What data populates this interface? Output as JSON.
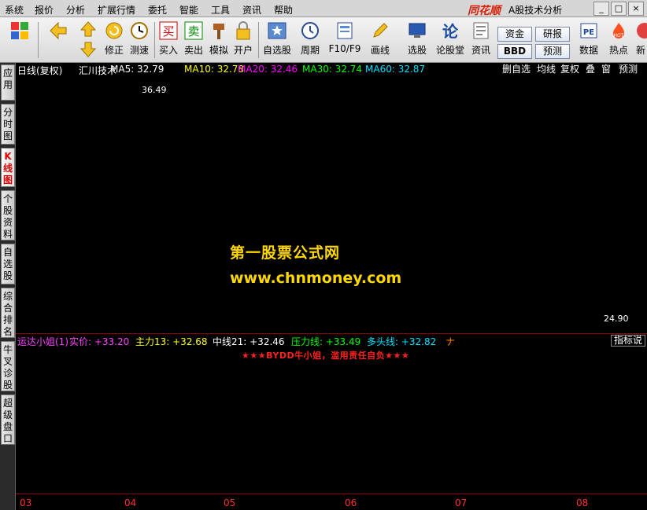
{
  "menubar": {
    "items": [
      "系统",
      "报价",
      "分析",
      "扩展行情",
      "委托",
      "智能",
      "工具",
      "资讯",
      "帮助"
    ],
    "brand": "同花顺",
    "app_title": "A股技术分析"
  },
  "toolbar": {
    "buttons": [
      "修正",
      "测速",
      "买入",
      "卖出",
      "模拟",
      "开户",
      "自选股",
      "周期",
      "F10/F9",
      "画线",
      "选股",
      "论股堂",
      "资讯",
      "数据",
      "热点",
      "新"
    ],
    "small_buttons": [
      "资金",
      "研报",
      "BBD",
      "预测"
    ]
  },
  "sidebar": {
    "items": [
      {
        "label": "应用",
        "active": false
      },
      {
        "label": "分时图",
        "active": false
      },
      {
        "label": "K线图",
        "active": true
      },
      {
        "label": "个股资料",
        "active": false
      },
      {
        "label": "自选股",
        "active": false
      },
      {
        "label": "综合排名",
        "active": false
      },
      {
        "label": "牛叉诊股",
        "active": false
      },
      {
        "label": "超级盘口",
        "active": false
      }
    ]
  },
  "kline": {
    "period": "日线(复权)",
    "stock_name": "汇川技术",
    "ma": [
      {
        "label": "MA5: 32.79",
        "dir": "up",
        "color": "#ffffff"
      },
      {
        "label": "MA10: 32.78",
        "dir": "up",
        "color": "#ffff00"
      },
      {
        "label": "MA20: 32.46",
        "dir": "up",
        "color": "#ff00ff"
      },
      {
        "label": "MA30: 32.74",
        "dir": "down",
        "color": "#00ff00"
      },
      {
        "label": "MA60: 32.87",
        "dir": "down",
        "color": "#00e0ff"
      }
    ],
    "right_buttons": [
      "删自选",
      "均线",
      "复权",
      "叠",
      "窗",
      "预测"
    ],
    "high_label": "36.49",
    "low_label": "24.90",
    "up_color": "#ff3030",
    "down_color": "#54ffff"
  },
  "watermark": {
    "line1": "第一股票公式网",
    "line2": "www.chnmoney.com"
  },
  "indicator": {
    "name": "运达小姐(1)",
    "values": [
      {
        "label": "实价: +33.20",
        "dir": "up",
        "color": "#ff40ff"
      },
      {
        "label": "主力13: +32.68",
        "dir": "up",
        "color": "#ffff00"
      },
      {
        "label": "中线21: +32.46",
        "dir": "up",
        "color": "#ffffff"
      },
      {
        "label": "压力线: +33.49",
        "dir": "up",
        "color": "#00ff00"
      },
      {
        "label": "多头线: +32.82",
        "dir": "up",
        "color": "#00e0ff"
      }
    ],
    "truncated": "ナ",
    "right_button": "指标说",
    "warning": "★★★BYDD牛小姐，滥用责任自负★★★"
  },
  "time_axis": {
    "labels": [
      "03",
      "04",
      "05",
      "06",
      "07",
      "08"
    ]
  }
}
